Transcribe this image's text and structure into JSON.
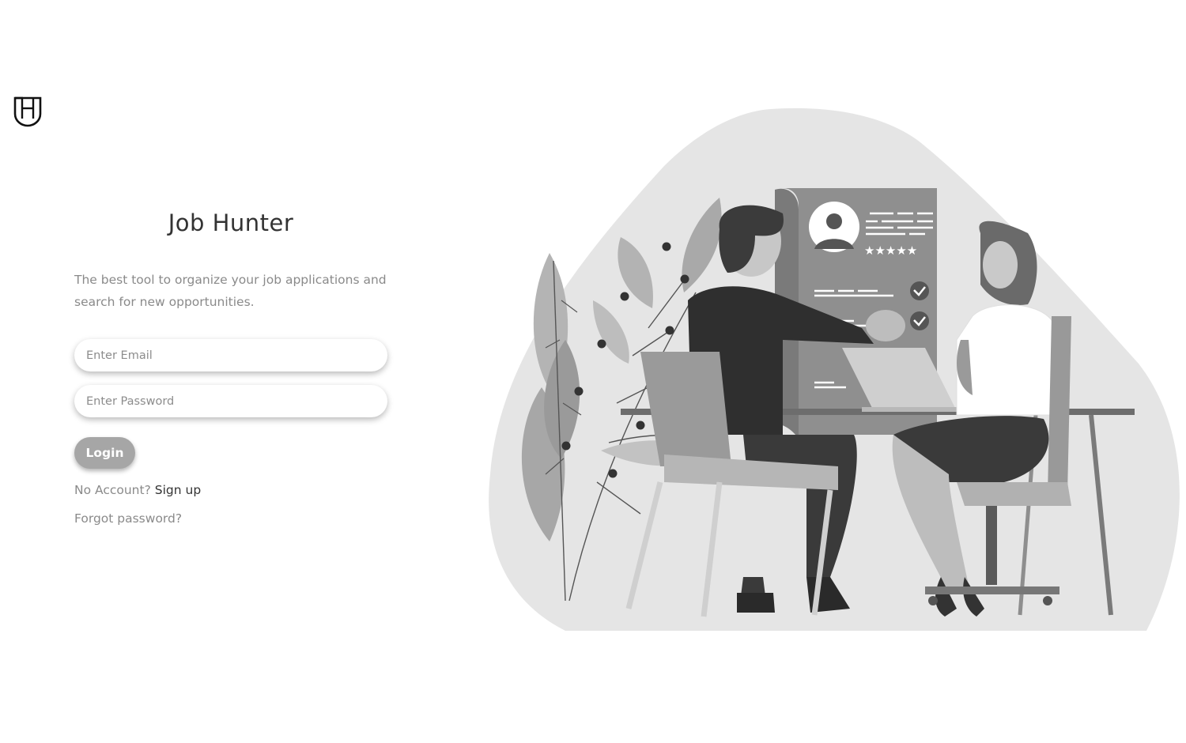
{
  "brand": {
    "logo_icon": "job-hunter-shield-logo",
    "logo_letters": "HJ"
  },
  "login": {
    "title": "Job Hunter",
    "tagline": "The best tool to organize your job applications and search for new opportunities.",
    "email_placeholder": "Enter Email",
    "email_value": "",
    "password_placeholder": "Enter Password",
    "password_value": "",
    "login_label": "Login",
    "no_account_text": "No Account?",
    "signup_label": "Sign up",
    "forgot_label": "Forgot password?"
  },
  "hero": {
    "image": "job-interview-handshake-illustration"
  },
  "colors": {
    "button_bg": "#a6a6a6",
    "text_dark": "#333333",
    "text_muted": "#8a8a8a",
    "blob": "#e5e5e5"
  }
}
